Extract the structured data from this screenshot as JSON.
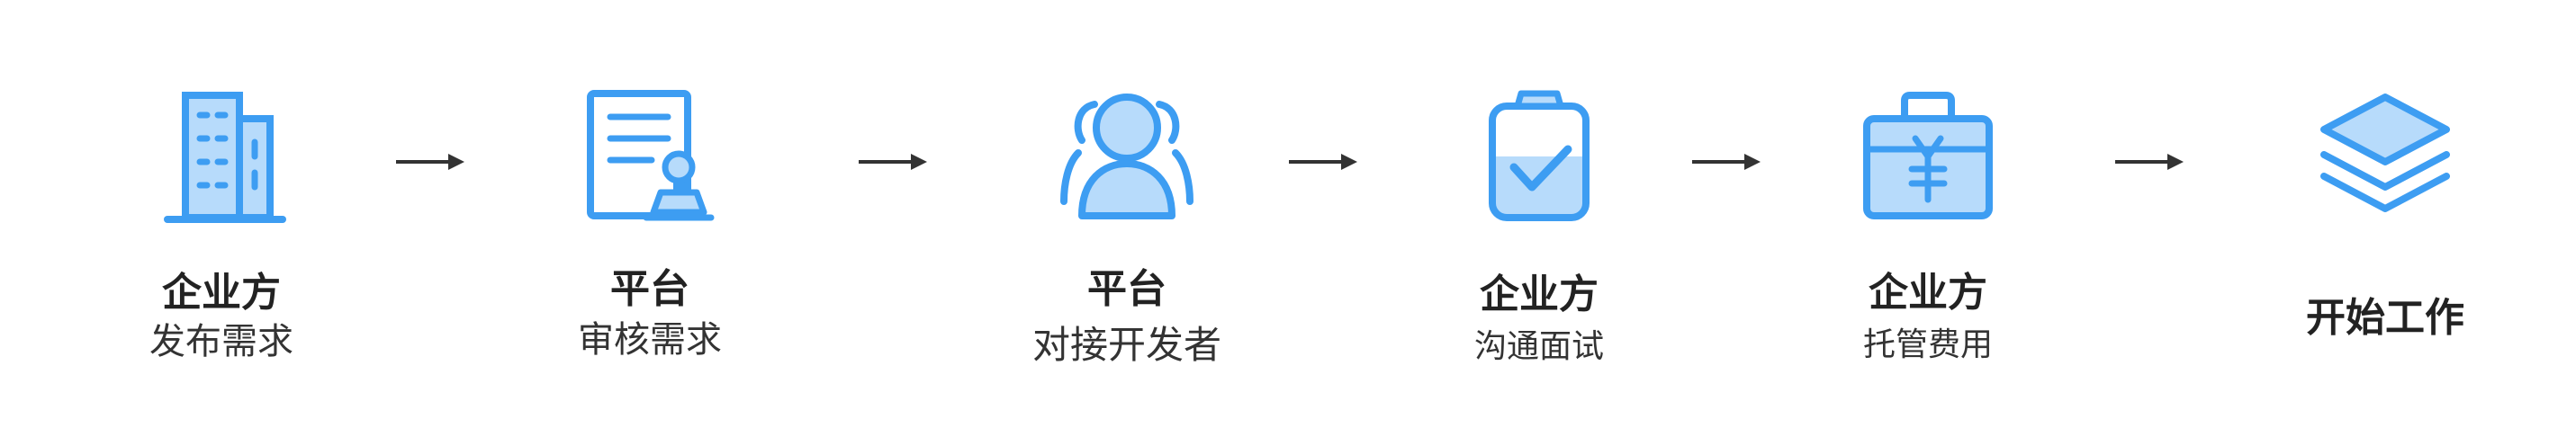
{
  "colors": {
    "primary": "#3d9df2",
    "light_fill": "#b7dbfb",
    "arrow": "#333333",
    "title_text": "#222222",
    "sub_text": "#333333"
  },
  "steps": [
    {
      "title": "企业方",
      "subtitle": "发布需求",
      "icon": "building-icon"
    },
    {
      "title": "平台",
      "subtitle": "审核需求",
      "icon": "document-review-icon"
    },
    {
      "title": "平台",
      "subtitle": "对接开发者",
      "icon": "developers-group-icon"
    },
    {
      "title": "企业方",
      "subtitle": "沟通面试",
      "icon": "clipboard-check-icon"
    },
    {
      "title": "企业方",
      "subtitle": "托管费用",
      "icon": "payment-case-icon"
    },
    {
      "title": "开始工作",
      "subtitle": "",
      "icon": "layers-icon"
    }
  ]
}
